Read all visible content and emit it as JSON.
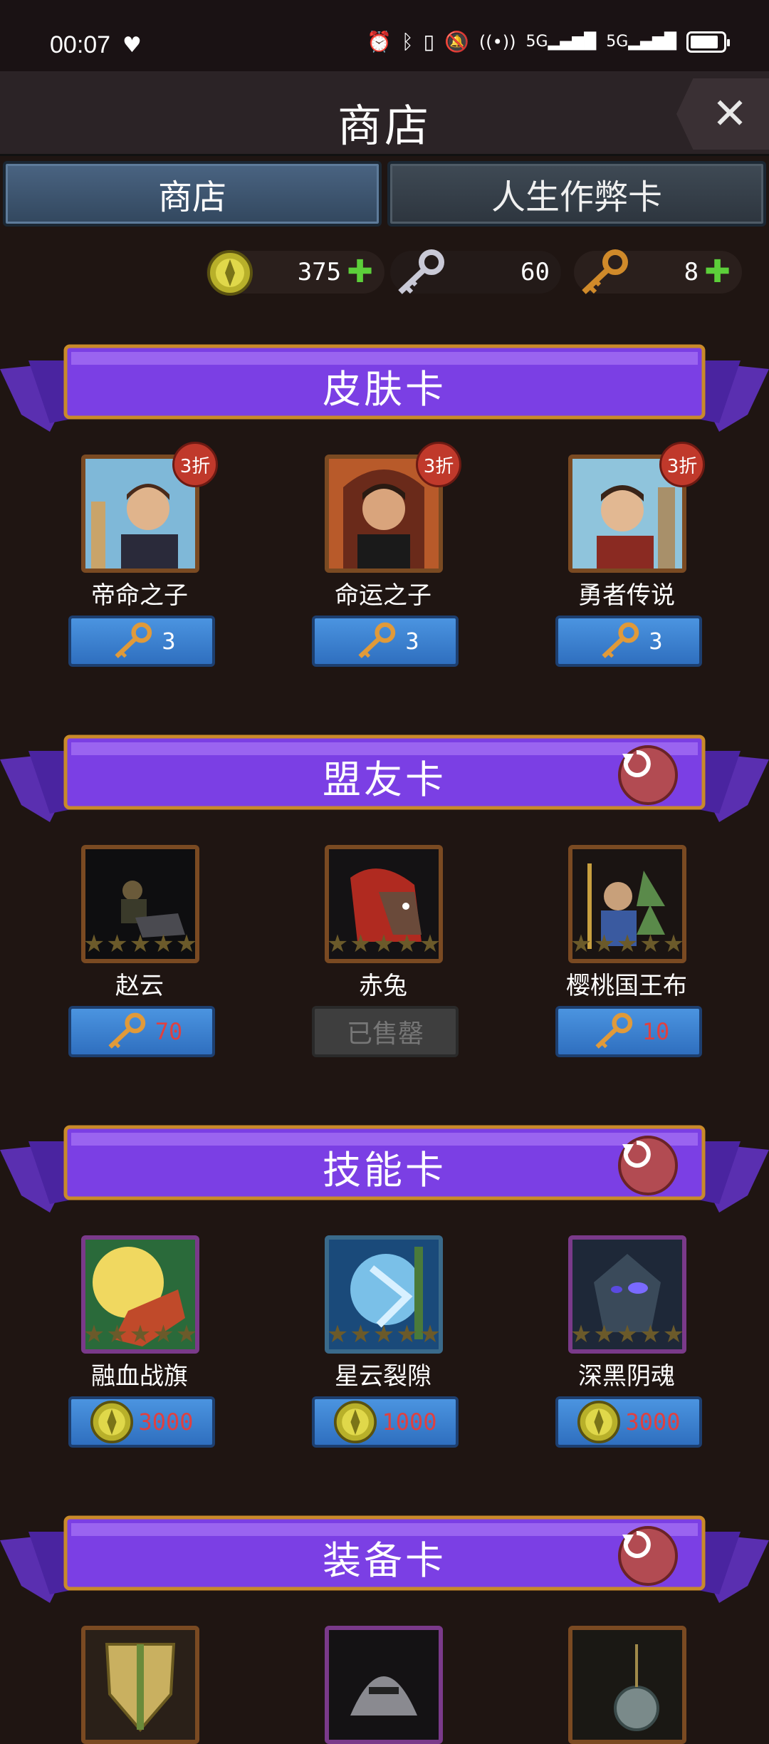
{
  "status": {
    "time": "00:07",
    "signal1": "5G",
    "signal2": "5G"
  },
  "header": {
    "title": "商店",
    "close": "✕"
  },
  "tabs": [
    {
      "label": "商店"
    },
    {
      "label": "人生作弊卡"
    }
  ],
  "currency": {
    "gold": "375",
    "silver_key": "60",
    "gold_key": "8"
  },
  "sections": [
    {
      "title": "皮肤卡",
      "cards": [
        {
          "name": "帝命之子",
          "discount": "3折",
          "price": "3",
          "currency": "key"
        },
        {
          "name": "命运之子",
          "discount": "3折",
          "price": "3",
          "currency": "key"
        },
        {
          "name": "勇者传说",
          "discount": "3折",
          "price": "3",
          "currency": "key"
        }
      ]
    },
    {
      "title": "盟友卡",
      "cards": [
        {
          "name": "赵云",
          "price": "70",
          "currency": "key"
        },
        {
          "name": "赤兔",
          "price": "已售罄",
          "currency": "sold"
        },
        {
          "name": "樱桃国王布",
          "price": "10",
          "currency": "key"
        }
      ]
    },
    {
      "title": "技能卡",
      "cards": [
        {
          "name": "融血战旗",
          "price": "3000",
          "currency": "gold"
        },
        {
          "name": "星云裂隙",
          "price": "1000",
          "currency": "gold"
        },
        {
          "name": "深黑阴魂",
          "price": "3000",
          "currency": "gold"
        }
      ]
    },
    {
      "title": "装备卡",
      "cards": []
    }
  ],
  "colors": {
    "banner": "#7b3fe4",
    "button": "#3b82d6",
    "price_red": "#e04040",
    "bg": "#1f1512"
  }
}
